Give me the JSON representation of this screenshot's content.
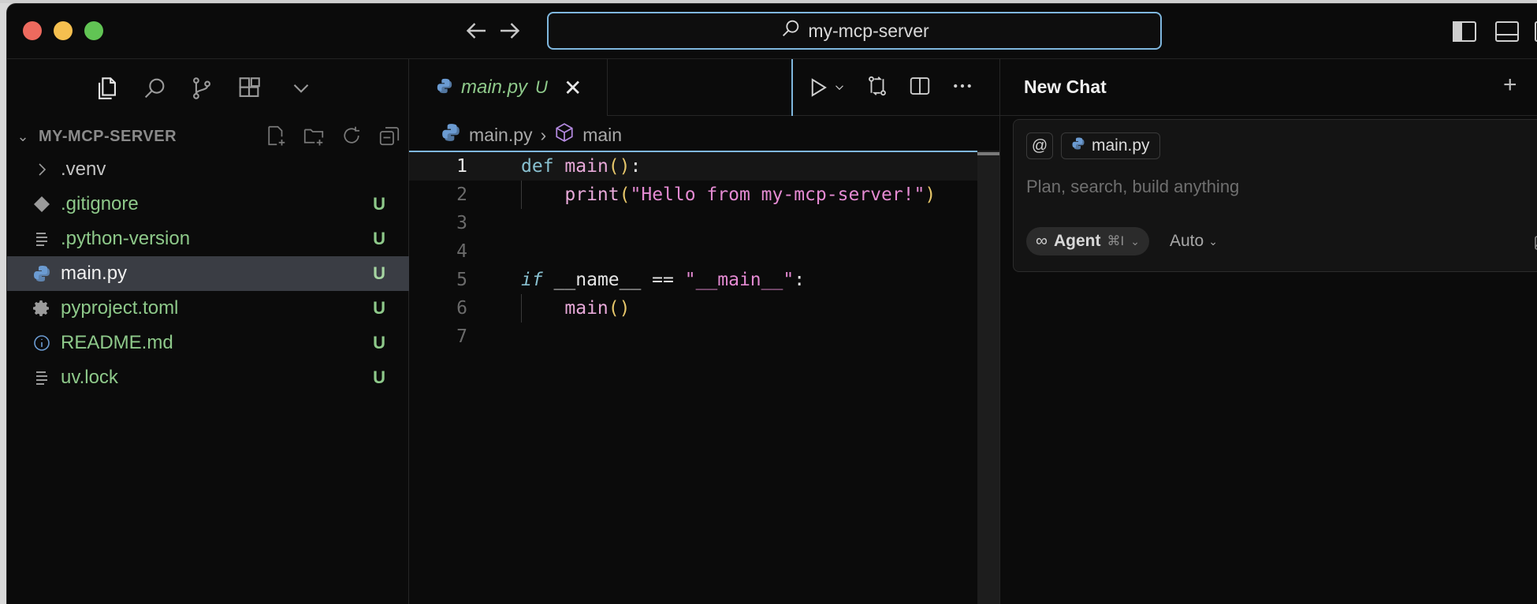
{
  "window": {
    "search_text": "my-mcp-server"
  },
  "sidebar": {
    "explorer_title": "MY-MCP-SERVER",
    "files": [
      {
        "name": ".venv",
        "badge": "",
        "icon": "chevron-right-icon",
        "kind": "folder"
      },
      {
        "name": ".gitignore",
        "badge": "U",
        "icon": "git-icon",
        "kind": "file"
      },
      {
        "name": ".python-version",
        "badge": "U",
        "icon": "lines-icon",
        "kind": "file"
      },
      {
        "name": "main.py",
        "badge": "U",
        "icon": "python-icon",
        "kind": "file",
        "selected": true
      },
      {
        "name": "pyproject.toml",
        "badge": "U",
        "icon": "gear-icon",
        "kind": "file"
      },
      {
        "name": "README.md",
        "badge": "U",
        "icon": "info-icon",
        "kind": "file"
      },
      {
        "name": "uv.lock",
        "badge": "U",
        "icon": "lines-icon",
        "kind": "file"
      }
    ]
  },
  "editor": {
    "tab": {
      "name": "main.py",
      "status": "U"
    },
    "breadcrumb": {
      "file": "main.py",
      "symbol": "main"
    },
    "line_numbers": [
      "1",
      "2",
      "3",
      "4",
      "5",
      "6",
      "7"
    ],
    "current_line": 1,
    "code": {
      "l1_kw": "def",
      "l1_fn": "main",
      "l1_parens": "()",
      "l1_colon": ":",
      "l2_fn": "print",
      "l2_open": "(",
      "l2_str": "\"Hello from my-mcp-server!\"",
      "l2_close": ")",
      "l5_kw": "if",
      "l5_rest": " __name__ == ",
      "l5_str": "\"__main__\"",
      "l5_colon": ":",
      "l6_fn": "main",
      "l6_parens": "()"
    }
  },
  "chat": {
    "title": "New Chat",
    "plus": "+",
    "at_symbol": "@",
    "context_file": "main.py",
    "placeholder": "Plan, search, build anything",
    "mode": "Agent",
    "mode_shortcut": "⌘I",
    "model": "Auto"
  },
  "colors": {
    "accent": "#7fb7de",
    "untracked_green": "#8ec98a",
    "selection": "#3a3d44"
  }
}
